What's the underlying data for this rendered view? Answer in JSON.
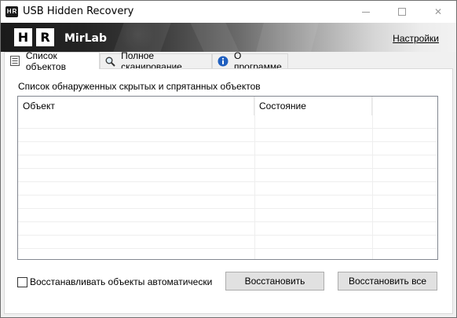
{
  "window": {
    "title": "USB Hidden Recovery",
    "app_icon_letters": [
      "H",
      "R"
    ],
    "controls": {
      "minimize": "minimize-icon",
      "maximize": "maximize-icon",
      "close": "✕"
    }
  },
  "banner": {
    "logo_letters": [
      "H",
      "R"
    ],
    "brand": "MirLab",
    "settings_link": "Настройки"
  },
  "tabs": [
    {
      "label": "Список объектов",
      "icon": "list-icon",
      "active": true
    },
    {
      "label": "Полное сканирование",
      "icon": "magnifier-icon",
      "active": false
    },
    {
      "label": "О программе",
      "icon": "info-icon",
      "active": false
    }
  ],
  "main": {
    "section_label": "Список обнаруженных скрытых и спрятанных объектов",
    "columns": [
      "Объект",
      "Состояние",
      ""
    ],
    "rows": []
  },
  "footer": {
    "auto_restore_label": "Восстанавливать объекты автоматически",
    "auto_restore_checked": false,
    "restore_button": "Восстановить",
    "restore_all_button": "Восстановить все"
  },
  "colors": {
    "accent_info": "#1f5fbf",
    "banner_dark": "#1a1a1a",
    "banner_light": "#f2f2f2"
  }
}
